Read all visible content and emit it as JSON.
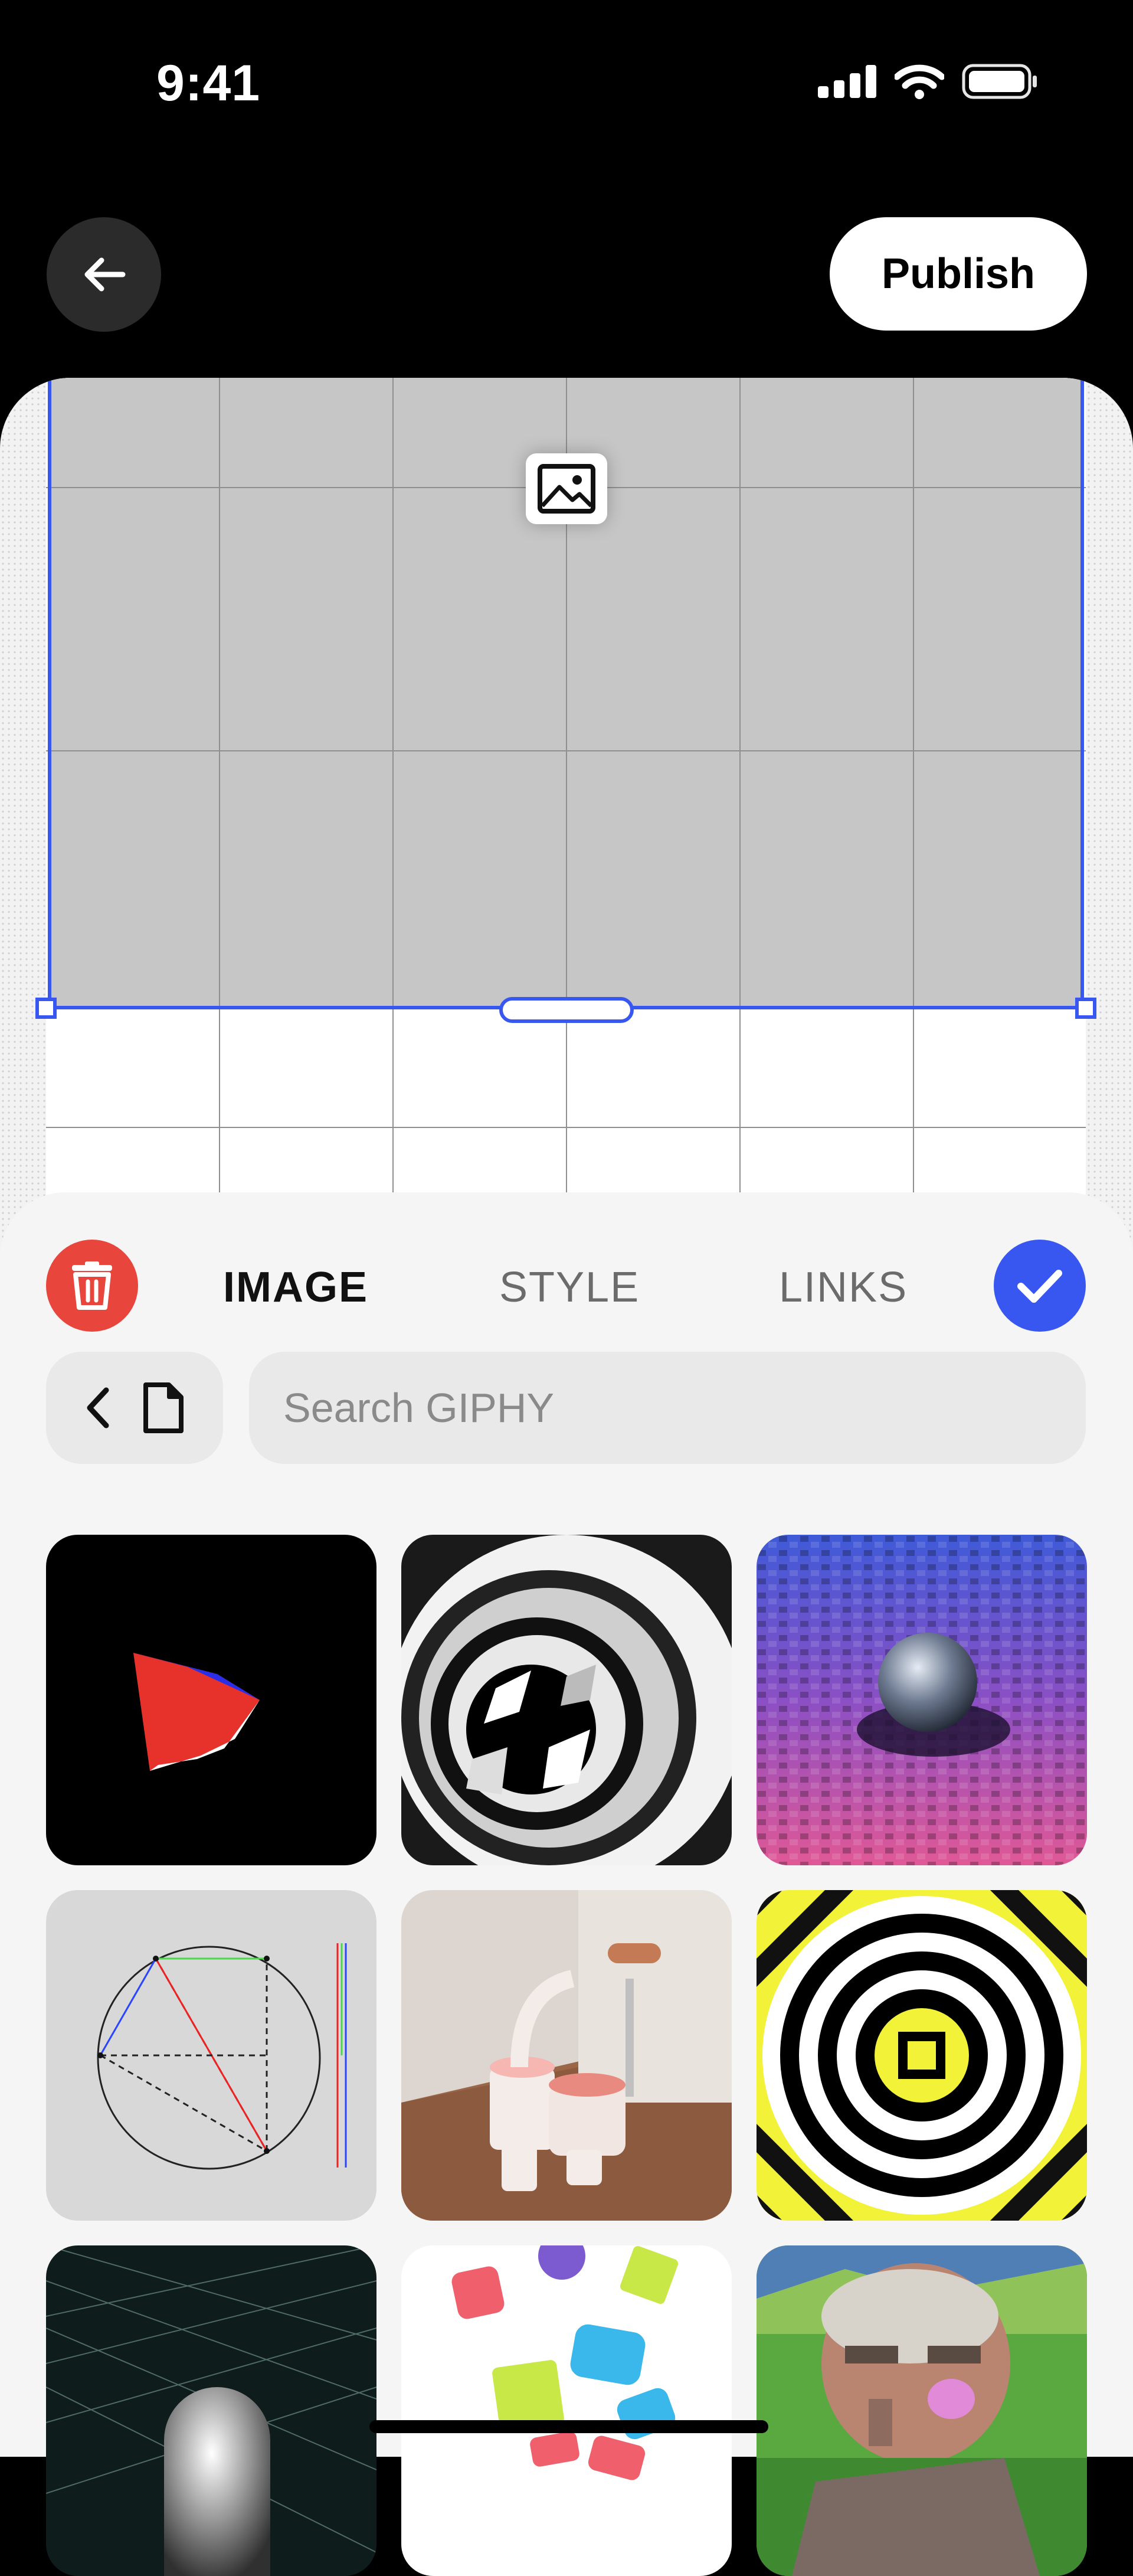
{
  "status_bar": {
    "time": "9:41",
    "icons": [
      "cellular-signal-icon",
      "wifi-icon",
      "battery-icon"
    ]
  },
  "header": {
    "back_icon": "arrow-left-icon",
    "publish_label": "Publish"
  },
  "canvas": {
    "placeholder_icon": "image-icon",
    "selection_color": "#3856f0"
  },
  "editor_panel": {
    "delete_icon": "trash-icon",
    "tabs": [
      {
        "label": "IMAGE",
        "active": true
      },
      {
        "label": "STYLE",
        "active": false
      },
      {
        "label": "LINKS",
        "active": false
      }
    ],
    "confirm_icon": "checkmark-icon",
    "source_nav": {
      "back_icon": "chevron-left-icon",
      "source_icon": "document-icon"
    },
    "search": {
      "placeholder": "Search GIPHY",
      "value": ""
    }
  },
  "results": {
    "items": [
      {
        "kind": "gif",
        "subject": "red and blue pyramid shape on black"
      },
      {
        "kind": "gif",
        "subject": "black and white checkered spiral tunnel"
      },
      {
        "kind": "gif",
        "subject": "chrome sphere on purple cube grid"
      },
      {
        "kind": "gif",
        "subject": "geometric circle diagram"
      },
      {
        "kind": "gif",
        "subject": "pink and white 3D sculpture in room"
      },
      {
        "kind": "gif",
        "subject": "black and white concentric circles on yellow stripes"
      },
      {
        "kind": "gif",
        "subject": "chrome dome on dark grid"
      },
      {
        "kind": "gif",
        "subject": "colorful falling shapes"
      },
      {
        "kind": "gif",
        "subject": "glitched portrait of a man"
      }
    ]
  },
  "colors": {
    "accent": "#3856f0",
    "delete": "#e8453c"
  }
}
